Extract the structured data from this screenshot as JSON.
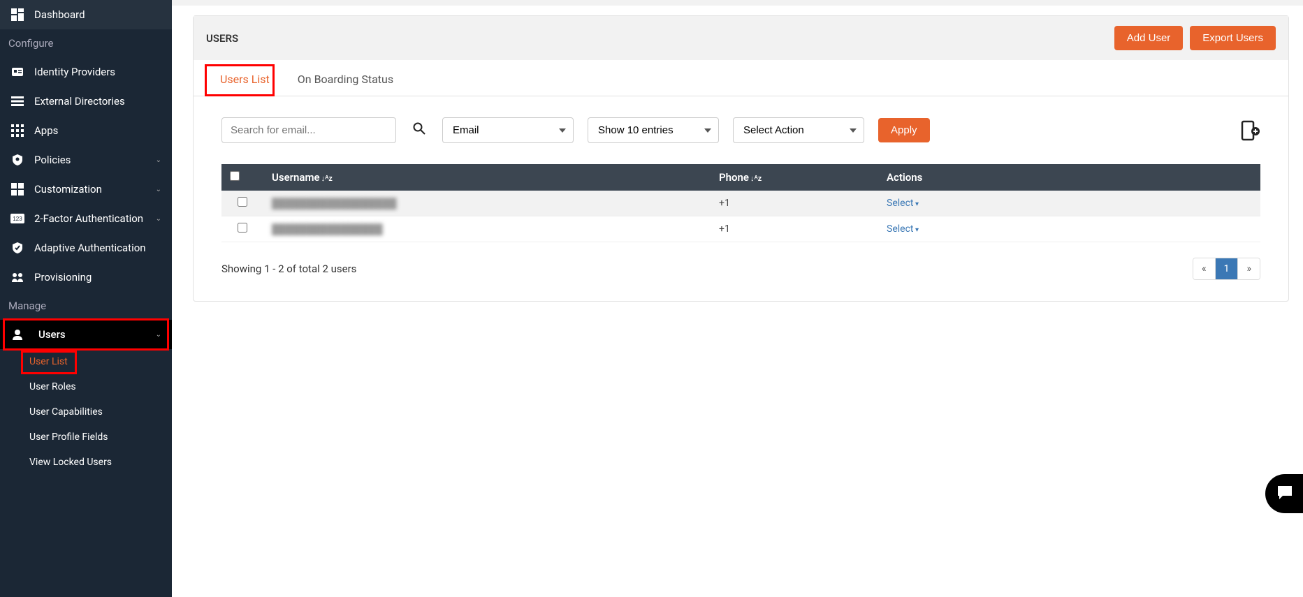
{
  "sidebar": {
    "dashboard": "Dashboard",
    "configure_section": "Configure",
    "identity_providers": "Identity Providers",
    "external_directories": "External Directories",
    "apps": "Apps",
    "policies": "Policies",
    "customization": "Customization",
    "two_factor": "2-Factor Authentication",
    "adaptive_auth": "Adaptive Authentication",
    "provisioning": "Provisioning",
    "manage_section": "Manage",
    "users": "Users",
    "users_sub": {
      "user_list": "User List",
      "user_roles": "User Roles",
      "user_capabilities": "User Capabilities",
      "user_profile_fields": "User Profile Fields",
      "view_locked_users": "View Locked Users"
    }
  },
  "header": {
    "title": "USERS",
    "add_user": "Add User",
    "export_users": "Export Users"
  },
  "tabs": {
    "users_list": "Users List",
    "onboarding": "On Boarding Status"
  },
  "filters": {
    "search_placeholder": "Search for email...",
    "email_label": "Email",
    "show_entries_label": "Show 10 entries",
    "select_action_label": "Select Action",
    "apply": "Apply"
  },
  "table": {
    "columns": {
      "username": "Username",
      "phone": "Phone",
      "actions": "Actions"
    },
    "rows": [
      {
        "username": "██████████████████",
        "phone": "+1",
        "action": "Select"
      },
      {
        "username": "████████████████",
        "phone": "+1",
        "action": "Select"
      }
    ],
    "summary": "Showing 1 - 2 of total 2 users"
  },
  "pagination": {
    "prev": "«",
    "current": "1",
    "next": "»"
  }
}
